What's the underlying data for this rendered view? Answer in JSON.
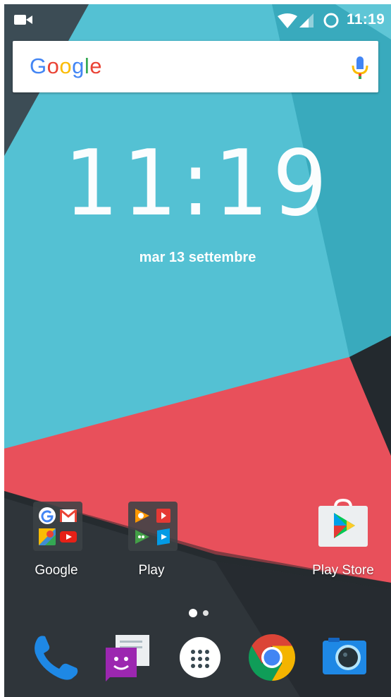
{
  "status_bar": {
    "time": "11:19",
    "icons": [
      "video-camera-icon",
      "wifi-icon",
      "signal-icon",
      "battery-charging-icon"
    ]
  },
  "search_bar": {
    "logo_letters": [
      "G",
      "o",
      "o",
      "g",
      "l",
      "e"
    ],
    "logo_colors": [
      "#4285F4",
      "#EA4335",
      "#FBBC05",
      "#4285F4",
      "#34A853",
      "#EA4335"
    ],
    "mic_icon": "mic-icon"
  },
  "clock": {
    "time": "11:19",
    "date": "mar 13 settembre"
  },
  "home_apps": [
    {
      "label": "Google",
      "icon": "google-folder-icon"
    },
    {
      "label": "Play",
      "icon": "play-folder-icon"
    },
    {
      "label": "Play Store",
      "icon": "play-store-icon"
    }
  ],
  "page_indicator": {
    "pages": 2,
    "current": 1
  },
  "dock": [
    {
      "icon": "phone-icon"
    },
    {
      "icon": "messenger-icon"
    },
    {
      "icon": "app-drawer-icon"
    },
    {
      "icon": "chrome-icon"
    },
    {
      "icon": "camera-icon"
    }
  ],
  "colors": {
    "teal": "#54C1D3",
    "teal_light": "#7DD0DE",
    "teal_dark": "#36A6BA",
    "red": "#E8505B",
    "dark": "#2C3237"
  }
}
